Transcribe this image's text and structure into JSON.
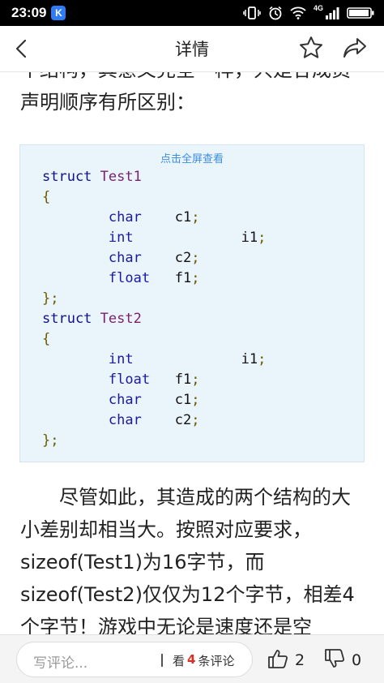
{
  "status_bar": {
    "time": "23:09",
    "app_badge": "K",
    "network": "4G"
  },
  "nav": {
    "title": "详情"
  },
  "article": {
    "para_top": "个结构，其意义完全一样，只是各成员声明顺序有所区别：",
    "code_block": {
      "fullscreen_label": "点击全屏查看",
      "lines": [
        [
          {
            "t": "struct",
            "c": "kw"
          },
          {
            "t": " "
          },
          {
            "t": "Test1",
            "c": "nm"
          }
        ],
        [
          {
            "t": "{",
            "c": "br"
          }
        ],
        [
          {
            "t": "        "
          },
          {
            "t": "char",
            "c": "ty"
          },
          {
            "t": "    "
          },
          {
            "t": "c1",
            "c": "id"
          },
          {
            "t": ";",
            "c": "br"
          }
        ],
        [
          {
            "t": "        "
          },
          {
            "t": "int",
            "c": "ty"
          },
          {
            "t": "             "
          },
          {
            "t": "i1",
            "c": "id"
          },
          {
            "t": ";",
            "c": "br"
          }
        ],
        [
          {
            "t": "        "
          },
          {
            "t": "char",
            "c": "ty"
          },
          {
            "t": "    "
          },
          {
            "t": "c2",
            "c": "id"
          },
          {
            "t": ";",
            "c": "br"
          }
        ],
        [
          {
            "t": "        "
          },
          {
            "t": "float",
            "c": "ty"
          },
          {
            "t": "   "
          },
          {
            "t": "f1",
            "c": "id"
          },
          {
            "t": ";",
            "c": "br"
          }
        ],
        [
          {
            "t": "};",
            "c": "br"
          }
        ],
        [
          {
            "t": "struct",
            "c": "kw"
          },
          {
            "t": " "
          },
          {
            "t": "Test2",
            "c": "nm"
          }
        ],
        [
          {
            "t": "{",
            "c": "br"
          }
        ],
        [
          {
            "t": "        "
          },
          {
            "t": "int",
            "c": "ty"
          },
          {
            "t": "             "
          },
          {
            "t": "i1",
            "c": "id"
          },
          {
            "t": ";",
            "c": "br"
          }
        ],
        [
          {
            "t": "        "
          },
          {
            "t": "float",
            "c": "ty"
          },
          {
            "t": "   "
          },
          {
            "t": "f1",
            "c": "id"
          },
          {
            "t": ";",
            "c": "br"
          }
        ],
        [
          {
            "t": "        "
          },
          {
            "t": "char",
            "c": "ty"
          },
          {
            "t": "    "
          },
          {
            "t": "c1",
            "c": "id"
          },
          {
            "t": ";",
            "c": "br"
          }
        ],
        [
          {
            "t": "        "
          },
          {
            "t": "char",
            "c": "ty"
          },
          {
            "t": "    "
          },
          {
            "t": "c2",
            "c": "id"
          },
          {
            "t": ";",
            "c": "br"
          }
        ],
        [
          {
            "t": "};",
            "c": "br"
          }
        ]
      ]
    },
    "para_bottom": "尽管如此，其造成的两个结构的大小差别却相当大。按照对应要求，sizeof(Test1)为16字节，而sizeof(Test2)仅仅为12个字节，相差4个字节！游戏中无论是速度还是空"
  },
  "bottom_bar": {
    "comment_placeholder": "写评论...",
    "view_prefix": "看",
    "comment_count": "4",
    "view_suffix": "条评论",
    "like_count": "2",
    "dislike_count": "0"
  },
  "colors": {
    "accent_link": "#3a8ee6",
    "comment_count": "#d93025",
    "code_background": "#eaf4fb"
  }
}
